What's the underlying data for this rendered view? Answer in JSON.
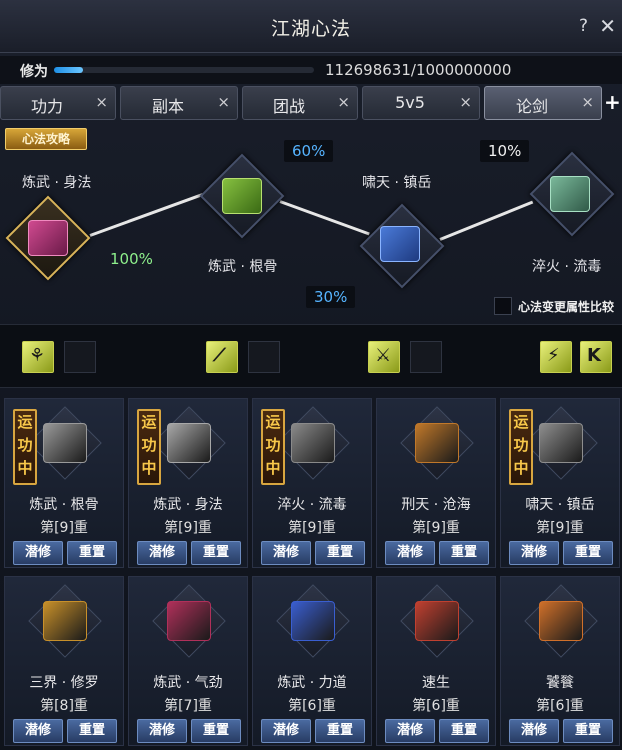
{
  "window": {
    "title": "江湖心法",
    "help": "?",
    "close": "✕"
  },
  "xp": {
    "label": "修为",
    "text": "112698631/1000000000",
    "progress": 0.113
  },
  "tabs": [
    {
      "label": "功力",
      "close": "×"
    },
    {
      "label": "副本",
      "close": "×"
    },
    {
      "label": "团战",
      "close": "×"
    },
    {
      "label": "5v5",
      "close": "×"
    },
    {
      "label": "论剑",
      "close": "×",
      "active": true
    }
  ],
  "tab_plus": "+",
  "strategy": {
    "badge": "心法攻略",
    "nodes": [
      {
        "label": "炼武 · 身法",
        "pct": "100%"
      },
      {
        "label": "炼武 · 根骨",
        "pct": "60%"
      },
      {
        "label": "啸天 · 镇岳",
        "pct": "30%"
      },
      {
        "label": "淬火 · 流毒",
        "pct": "10%"
      }
    ],
    "compare_label": "心法变更属性比较"
  },
  "skills": [
    "skill-icon-1",
    "skill-icon-2",
    "skill-icon-3",
    "skill-icon-4",
    "skill-icon-5"
  ],
  "cards": [
    {
      "name": "炼武 · 根骨",
      "level": "第[9]重",
      "running": true,
      "color": "#9a9a9a"
    },
    {
      "name": "炼武 · 身法",
      "level": "第[9]重",
      "running": true,
      "color": "#a8a8a8"
    },
    {
      "name": "淬火 · 流毒",
      "level": "第[9]重",
      "running": true,
      "color": "#8a8a8a"
    },
    {
      "name": "刑天 · 沧海",
      "level": "第[9]重",
      "running": false,
      "color": "#c0782a"
    },
    {
      "name": "啸天 · 镇岳",
      "level": "第[9]重",
      "running": true,
      "color": "#8e8e8e"
    },
    {
      "name": "三界 · 修罗",
      "level": "第[8]重",
      "running": false,
      "color": "#c8902a"
    },
    {
      "name": "炼武 · 气劲",
      "level": "第[7]重",
      "running": false,
      "color": "#b0305a"
    },
    {
      "name": "炼武 · 力道",
      "level": "第[6]重",
      "running": false,
      "color": "#3a5ed0"
    },
    {
      "name": "速生",
      "level": "第[6]重",
      "running": false,
      "color": "#c04030"
    },
    {
      "name": "饕餮",
      "level": "第[6]重",
      "running": false,
      "color": "#d0702a"
    }
  ],
  "running_text": [
    "运",
    "功",
    "中"
  ],
  "btn_train": "潜修",
  "btn_reset": "重置"
}
